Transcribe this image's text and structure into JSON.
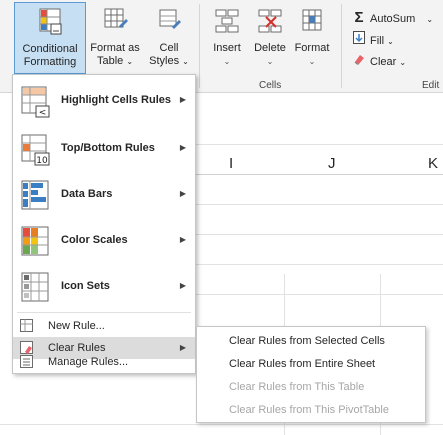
{
  "ribbon": {
    "conditional_formatting": {
      "line1": "Conditional",
      "line2": "Formatting"
    },
    "format_as_table": {
      "line1": "Format as",
      "line2": "Table"
    },
    "cell_styles": {
      "line1": "Cell",
      "line2": "Styles"
    },
    "insert": "Insert",
    "delete": "Delete",
    "format": "Format",
    "cells_group_label": "Cells",
    "edit_group_label": "Edit",
    "autosum": "AutoSum",
    "fill": "Fill",
    "clear": "Clear"
  },
  "sheet": {
    "columns": [
      "I",
      "J",
      "K"
    ]
  },
  "menu": {
    "items": [
      {
        "label": "Highlight Cells Rules",
        "icon": "highlight-cells-icon"
      },
      {
        "label": "Top/Bottom Rules",
        "icon": "top-bottom-icon"
      },
      {
        "label": "Data Bars",
        "icon": "data-bars-icon"
      },
      {
        "label": "Color Scales",
        "icon": "color-scales-icon"
      },
      {
        "label": "Icon Sets",
        "icon": "icon-sets-icon"
      }
    ],
    "new_rule": "New Rule...",
    "clear_rules": "Clear Rules",
    "manage_rules": "Manage Rules...",
    "icon_badges": {
      "highlight": "<",
      "top_bottom": "10"
    }
  },
  "submenu": {
    "items": [
      {
        "label": "Clear Rules from Selected Cells",
        "enabled": true
      },
      {
        "label": "Clear Rules from Entire Sheet",
        "enabled": true
      },
      {
        "label": "Clear Rules from This Table",
        "enabled": false
      },
      {
        "label": "Clear Rules from This PivotTable",
        "enabled": false
      }
    ]
  },
  "colors": {
    "accent": "#5a9bd5",
    "selected_button": "#c6dff3",
    "hover_row": "#dcdcdc",
    "disabled_text": "#a6a6a6"
  }
}
